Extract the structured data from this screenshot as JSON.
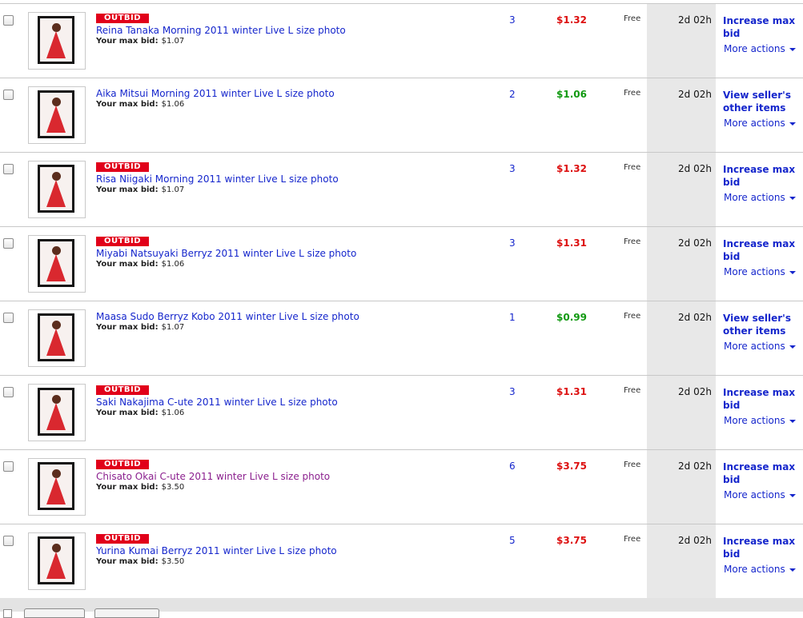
{
  "items": [
    {
      "outbid": true,
      "badge": "OUTBID",
      "title": "Reina Tanaka Morning 2011 winter Live L size photo",
      "visited": false,
      "maxbid_label": "Your max bid:",
      "maxbid": "$1.07",
      "bids": "3",
      "price": "$1.32",
      "price_status": "outbid",
      "shipping": "Free",
      "time_left": "2d 02h",
      "action": "Increase max bid",
      "more": "More actions"
    },
    {
      "outbid": false,
      "badge": "",
      "title": "Aika Mitsui Morning 2011 winter Live L size photo",
      "visited": false,
      "maxbid_label": "Your max bid:",
      "maxbid": "$1.06",
      "bids": "2",
      "price": "$1.06",
      "price_status": "winning",
      "shipping": "Free",
      "time_left": "2d 02h",
      "action": "View seller's other items",
      "more": "More actions"
    },
    {
      "outbid": true,
      "badge": "OUTBID",
      "title": "Risa Niigaki Morning 2011 winter Live L size photo",
      "visited": false,
      "maxbid_label": "Your max bid:",
      "maxbid": "$1.07",
      "bids": "3",
      "price": "$1.32",
      "price_status": "outbid",
      "shipping": "Free",
      "time_left": "2d 02h",
      "action": "Increase max bid",
      "more": "More actions"
    },
    {
      "outbid": true,
      "badge": "OUTBID",
      "title": "Miyabi Natsuyaki Berryz 2011 winter Live L size photo",
      "visited": false,
      "maxbid_label": "Your max bid:",
      "maxbid": "$1.06",
      "bids": "3",
      "price": "$1.31",
      "price_status": "outbid",
      "shipping": "Free",
      "time_left": "2d 02h",
      "action": "Increase max bid",
      "more": "More actions"
    },
    {
      "outbid": false,
      "badge": "",
      "title": "Maasa Sudo Berryz Kobo 2011 winter Live L size photo",
      "visited": false,
      "maxbid_label": "Your max bid:",
      "maxbid": "$1.07",
      "bids": "1",
      "price": "$0.99",
      "price_status": "winning",
      "shipping": "Free",
      "time_left": "2d 02h",
      "action": "View seller's other items",
      "more": "More actions"
    },
    {
      "outbid": true,
      "badge": "OUTBID",
      "title": "Saki Nakajima C-ute 2011 winter Live L size photo",
      "visited": false,
      "maxbid_label": "Your max bid:",
      "maxbid": "$1.06",
      "bids": "3",
      "price": "$1.31",
      "price_status": "outbid",
      "shipping": "Free",
      "time_left": "2d 02h",
      "action": "Increase max bid",
      "more": "More actions"
    },
    {
      "outbid": true,
      "badge": "OUTBID",
      "title": "Chisato Okai C-ute 2011 winter Live L size photo",
      "visited": true,
      "maxbid_label": "Your max bid:",
      "maxbid": "$3.50",
      "bids": "6",
      "price": "$3.75",
      "price_status": "outbid",
      "shipping": "Free",
      "time_left": "2d 02h",
      "action": "Increase max bid",
      "more": "More actions"
    },
    {
      "outbid": true,
      "badge": "OUTBID",
      "title": "Yurina Kumai Berryz 2011 winter Live L size photo",
      "visited": false,
      "maxbid_label": "Your max bid:",
      "maxbid": "$3.50",
      "bids": "5",
      "price": "$3.75",
      "price_status": "outbid",
      "shipping": "Free",
      "time_left": "2d 02h",
      "action": "Increase max bid",
      "more": "More actions"
    }
  ],
  "colors": {
    "link": "#1526cc",
    "visited_link": "#8b1f8e",
    "outbid_price": "#dd1111",
    "winning_price": "#119911",
    "badge_bg": "#e1001a"
  }
}
